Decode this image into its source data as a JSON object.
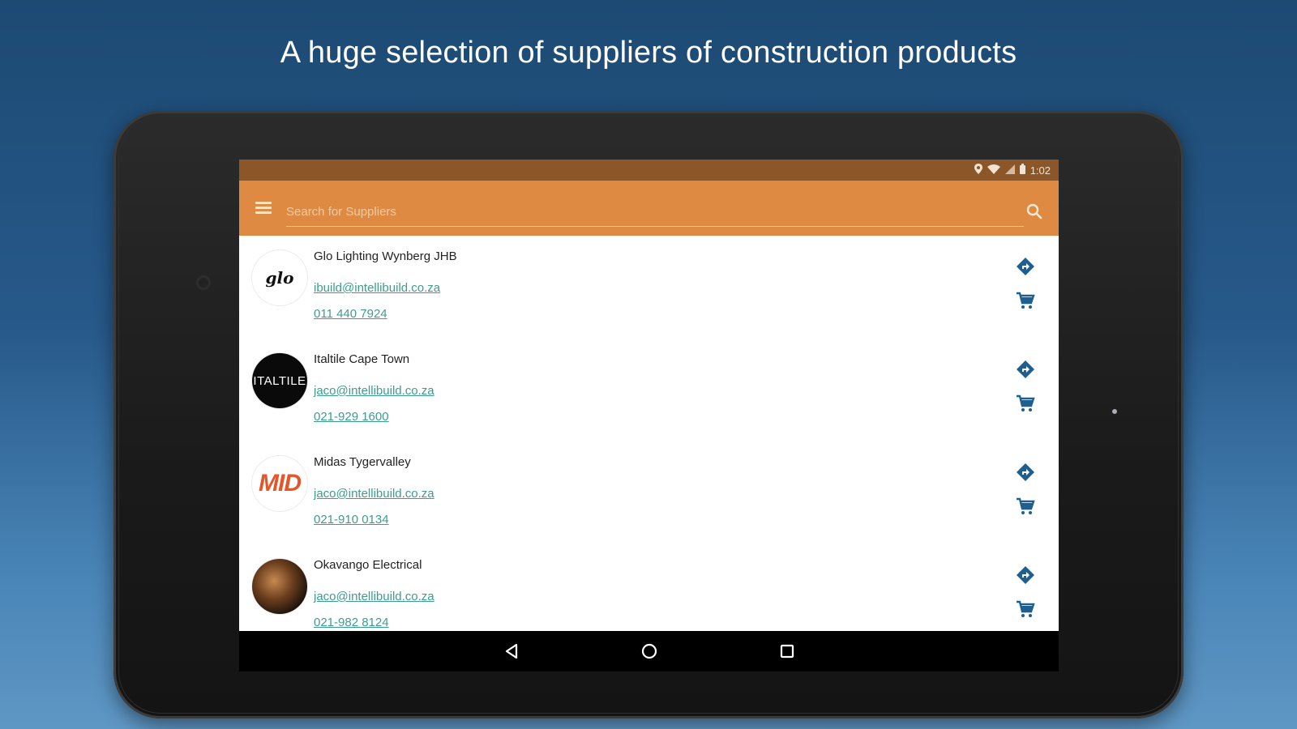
{
  "headline": "A huge selection of suppliers of construction products",
  "status_bar": {
    "time": "1:02",
    "icons": [
      "location-icon",
      "wifi-icon",
      "signal-icon",
      "battery-icon"
    ]
  },
  "toolbar": {
    "menu_icon": "hamburger-menu-icon",
    "search_placeholder": "Search for Suppliers",
    "search_value": "",
    "search_icon": "search-icon"
  },
  "suppliers": [
    {
      "name": "Glo Lighting Wynberg JHB",
      "email": "ibuild@intellibuild.co.za",
      "phone": "011 440 7924",
      "logo_text": "glo"
    },
    {
      "name": "Italtile Cape Town",
      "email": "jaco@intellibuild.co.za",
      "phone": "021-929 1600",
      "logo_text": "ITALTILE"
    },
    {
      "name": "Midas Tygervalley",
      "email": "jaco@intellibuild.co.za",
      "phone": "021-910 0134",
      "logo_text": "MID"
    },
    {
      "name": "Okavango Electrical",
      "email": "jaco@intellibuild.co.za",
      "phone": "021-982 8124",
      "logo_text": ""
    }
  ],
  "nav_bar": {
    "buttons": [
      "back-icon",
      "home-icon",
      "recents-icon"
    ]
  },
  "colors": {
    "accent": "#de8a43",
    "status_bar": "#8b5729",
    "link": "#3e9c8e",
    "action_icon": "#1f5f8f"
  }
}
